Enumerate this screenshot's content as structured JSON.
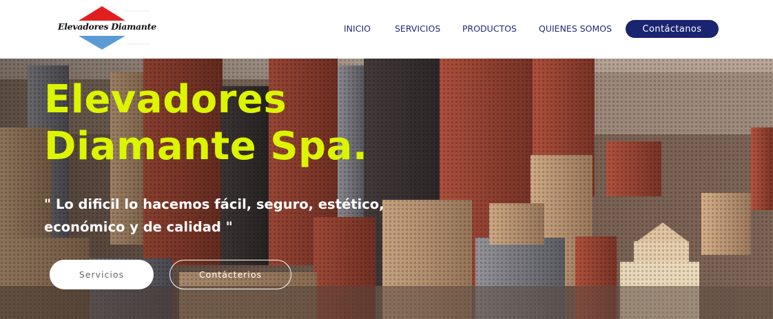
{
  "header": {
    "logo_text": "Elevadores Diamante",
    "logo_colors": {
      "top_triangle": "#e02020",
      "bottom_triangle": "#5b9bd5"
    },
    "nav": [
      {
        "label": "INICIO"
      },
      {
        "label": "SERVICIOS"
      },
      {
        "label": "PRODUCTOS"
      },
      {
        "label": "QUIENES SOMOS"
      }
    ],
    "cta_label": "Contáctanos"
  },
  "hero": {
    "title_line1": "Elevadores",
    "title_line2": "Diamante Spa.",
    "quote_line1": "\" Lo dificil lo hacemos fácil, seguro, estético,",
    "quote_line2": "económico y de calidad \"",
    "primary_button": "Servicios",
    "secondary_button": "Contácterios",
    "colors": {
      "title": "#dcf500",
      "quote": "#ffffff"
    }
  },
  "colors": {
    "brand_navy": "#1b2470",
    "nav_text": "#1e2a78"
  }
}
